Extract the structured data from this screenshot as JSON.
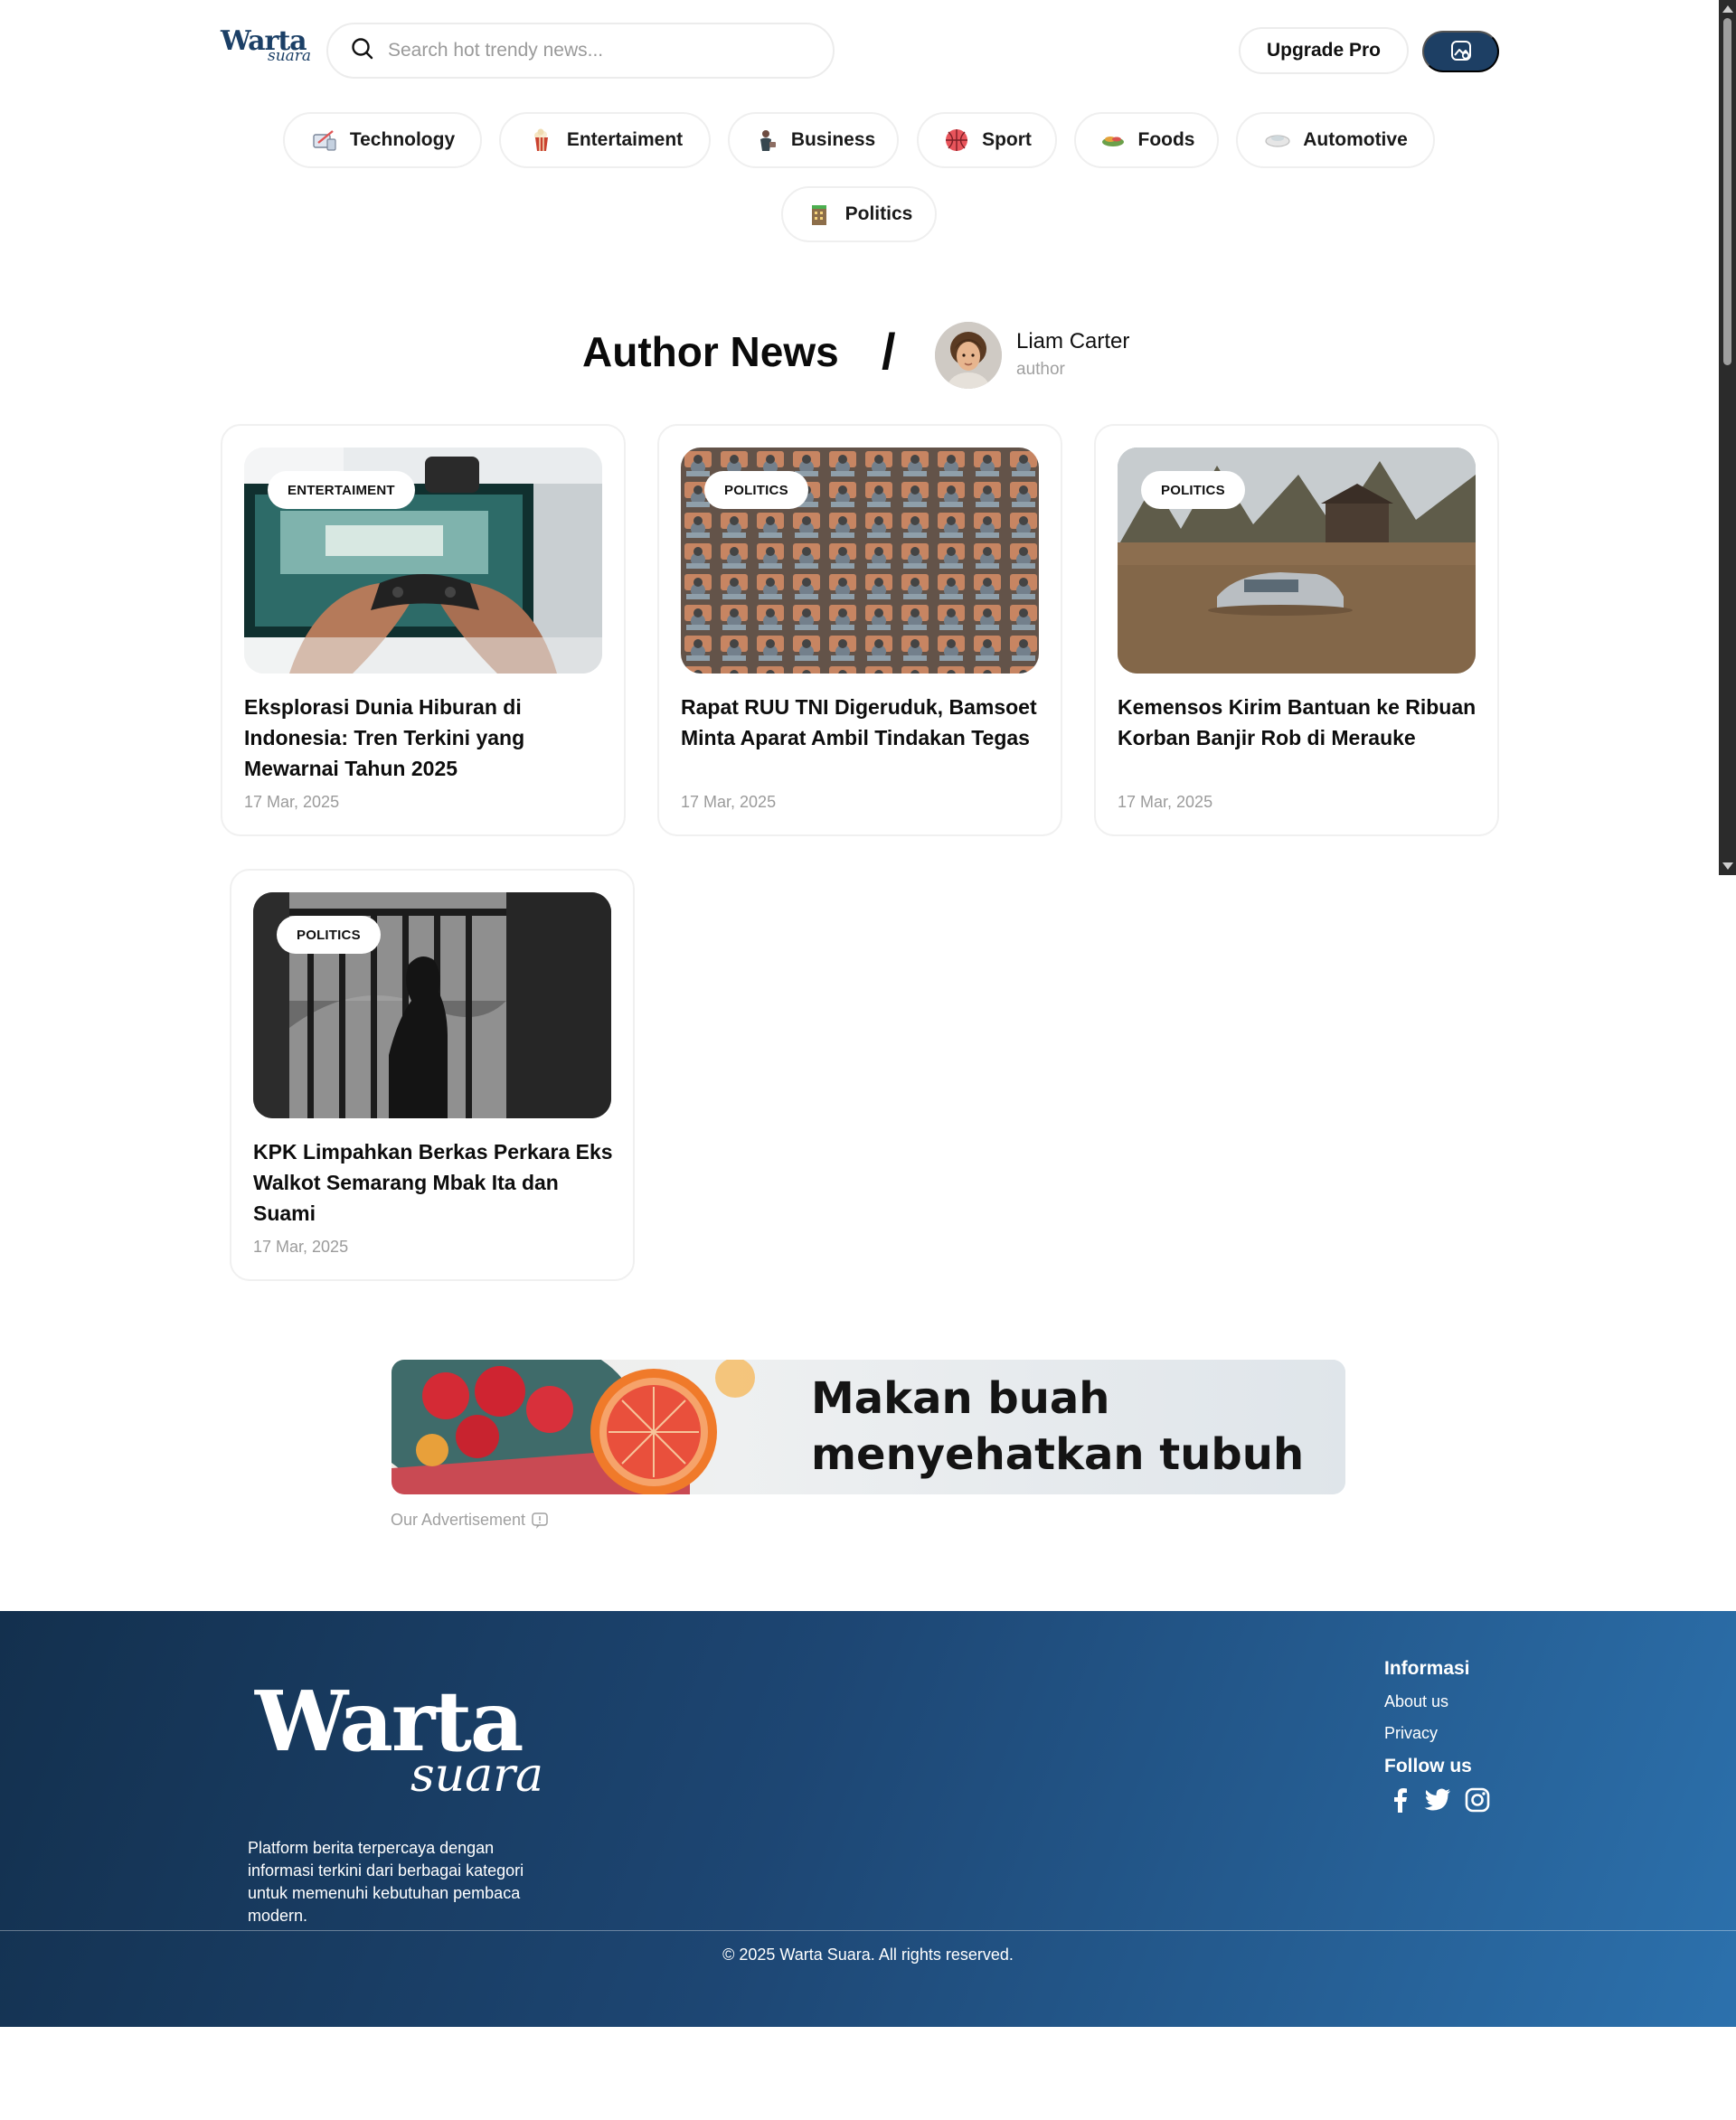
{
  "header": {
    "logo_main": "Warta",
    "logo_sub": "suara",
    "search_placeholder": "Search hot trendy news...",
    "upgrade_label": "Upgrade Pro",
    "gallery_icon": "image-gallery-icon"
  },
  "categories": [
    {
      "label": "Technology",
      "icon": "technology-icon"
    },
    {
      "label": "Entertaiment",
      "icon": "popcorn-icon"
    },
    {
      "label": "Business",
      "icon": "business-icon"
    },
    {
      "label": "Sport",
      "icon": "basketball-icon"
    },
    {
      "label": "Foods",
      "icon": "food-icon"
    },
    {
      "label": "Automotive",
      "icon": "car-icon"
    },
    {
      "label": "Politics",
      "icon": "building-icon"
    }
  ],
  "author_section": {
    "title": "Author News",
    "separator": "/",
    "author_name": "Liam Carter",
    "author_role": "author"
  },
  "articles": [
    {
      "category": "ENTERTAIMENT",
      "title": "Eksplorasi Dunia Hiburan di Indonesia: Tren Terkini yang Mewarnai Tahun 2025",
      "date": "17 Mar, 2025"
    },
    {
      "category": "POLITICS",
      "title": "Rapat RUU TNI Digeruduk, Bamsoet Minta Aparat Ambil Tindakan Tegas",
      "date": "17 Mar, 2025"
    },
    {
      "category": "POLITICS",
      "title": "Kemensos Kirim Bantuan ke Ribuan Korban Banjir Rob di Merauke",
      "date": "17 Mar, 2025"
    },
    {
      "category": "POLITICS",
      "title": "KPK Limpahkan Berkas Perkara Eks Walkot Semarang Mbak Ita dan Suami",
      "date": "17 Mar, 2025"
    }
  ],
  "advertisement": {
    "headline_line1": "Makan buah",
    "headline_line2": "menyehatkan tubuh",
    "label": "Our Advertisement"
  },
  "footer": {
    "logo_main": "Warta",
    "logo_sub": "suara",
    "description": "Platform berita terpercaya dengan informasi terkini dari berbagai kategori untuk memenuhi kebutuhan pembaca modern.",
    "info_heading": "Informasi",
    "about_label": "About us",
    "privacy_label": "Privacy",
    "follow_heading": "Follow us",
    "social_icons": [
      "facebook-icon",
      "twitter-icon",
      "instagram-icon"
    ],
    "copyright": "© 2025 Warta Suara. All rights reserved."
  },
  "colors": {
    "brand_navy": "#1d3f64",
    "footer_gradient_start": "#13304e",
    "footer_gradient_end": "#2c71ad",
    "muted_text": "#9b9b9b"
  }
}
